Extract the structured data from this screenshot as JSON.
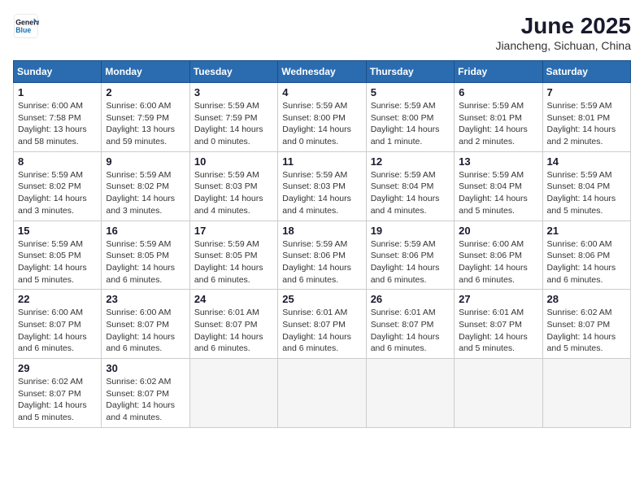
{
  "logo": {
    "line1": "General",
    "line2": "Blue"
  },
  "title": "June 2025",
  "subtitle": "Jiancheng, Sichuan, China",
  "days_of_week": [
    "Sunday",
    "Monday",
    "Tuesday",
    "Wednesday",
    "Thursday",
    "Friday",
    "Saturday"
  ],
  "weeks": [
    [
      {
        "day": "1",
        "info": "Sunrise: 6:00 AM\nSunset: 7:58 PM\nDaylight: 13 hours\nand 58 minutes."
      },
      {
        "day": "2",
        "info": "Sunrise: 6:00 AM\nSunset: 7:59 PM\nDaylight: 13 hours\nand 59 minutes."
      },
      {
        "day": "3",
        "info": "Sunrise: 5:59 AM\nSunset: 7:59 PM\nDaylight: 14 hours\nand 0 minutes."
      },
      {
        "day": "4",
        "info": "Sunrise: 5:59 AM\nSunset: 8:00 PM\nDaylight: 14 hours\nand 0 minutes."
      },
      {
        "day": "5",
        "info": "Sunrise: 5:59 AM\nSunset: 8:00 PM\nDaylight: 14 hours\nand 1 minute."
      },
      {
        "day": "6",
        "info": "Sunrise: 5:59 AM\nSunset: 8:01 PM\nDaylight: 14 hours\nand 2 minutes."
      },
      {
        "day": "7",
        "info": "Sunrise: 5:59 AM\nSunset: 8:01 PM\nDaylight: 14 hours\nand 2 minutes."
      }
    ],
    [
      {
        "day": "8",
        "info": "Sunrise: 5:59 AM\nSunset: 8:02 PM\nDaylight: 14 hours\nand 3 minutes."
      },
      {
        "day": "9",
        "info": "Sunrise: 5:59 AM\nSunset: 8:02 PM\nDaylight: 14 hours\nand 3 minutes."
      },
      {
        "day": "10",
        "info": "Sunrise: 5:59 AM\nSunset: 8:03 PM\nDaylight: 14 hours\nand 4 minutes."
      },
      {
        "day": "11",
        "info": "Sunrise: 5:59 AM\nSunset: 8:03 PM\nDaylight: 14 hours\nand 4 minutes."
      },
      {
        "day": "12",
        "info": "Sunrise: 5:59 AM\nSunset: 8:04 PM\nDaylight: 14 hours\nand 4 minutes."
      },
      {
        "day": "13",
        "info": "Sunrise: 5:59 AM\nSunset: 8:04 PM\nDaylight: 14 hours\nand 5 minutes."
      },
      {
        "day": "14",
        "info": "Sunrise: 5:59 AM\nSunset: 8:04 PM\nDaylight: 14 hours\nand 5 minutes."
      }
    ],
    [
      {
        "day": "15",
        "info": "Sunrise: 5:59 AM\nSunset: 8:05 PM\nDaylight: 14 hours\nand 5 minutes."
      },
      {
        "day": "16",
        "info": "Sunrise: 5:59 AM\nSunset: 8:05 PM\nDaylight: 14 hours\nand 6 minutes."
      },
      {
        "day": "17",
        "info": "Sunrise: 5:59 AM\nSunset: 8:05 PM\nDaylight: 14 hours\nand 6 minutes."
      },
      {
        "day": "18",
        "info": "Sunrise: 5:59 AM\nSunset: 8:06 PM\nDaylight: 14 hours\nand 6 minutes."
      },
      {
        "day": "19",
        "info": "Sunrise: 5:59 AM\nSunset: 8:06 PM\nDaylight: 14 hours\nand 6 minutes."
      },
      {
        "day": "20",
        "info": "Sunrise: 6:00 AM\nSunset: 8:06 PM\nDaylight: 14 hours\nand 6 minutes."
      },
      {
        "day": "21",
        "info": "Sunrise: 6:00 AM\nSunset: 8:06 PM\nDaylight: 14 hours\nand 6 minutes."
      }
    ],
    [
      {
        "day": "22",
        "info": "Sunrise: 6:00 AM\nSunset: 8:07 PM\nDaylight: 14 hours\nand 6 minutes."
      },
      {
        "day": "23",
        "info": "Sunrise: 6:00 AM\nSunset: 8:07 PM\nDaylight: 14 hours\nand 6 minutes."
      },
      {
        "day": "24",
        "info": "Sunrise: 6:01 AM\nSunset: 8:07 PM\nDaylight: 14 hours\nand 6 minutes."
      },
      {
        "day": "25",
        "info": "Sunrise: 6:01 AM\nSunset: 8:07 PM\nDaylight: 14 hours\nand 6 minutes."
      },
      {
        "day": "26",
        "info": "Sunrise: 6:01 AM\nSunset: 8:07 PM\nDaylight: 14 hours\nand 6 minutes."
      },
      {
        "day": "27",
        "info": "Sunrise: 6:01 AM\nSunset: 8:07 PM\nDaylight: 14 hours\nand 5 minutes."
      },
      {
        "day": "28",
        "info": "Sunrise: 6:02 AM\nSunset: 8:07 PM\nDaylight: 14 hours\nand 5 minutes."
      }
    ],
    [
      {
        "day": "29",
        "info": "Sunrise: 6:02 AM\nSunset: 8:07 PM\nDaylight: 14 hours\nand 5 minutes."
      },
      {
        "day": "30",
        "info": "Sunrise: 6:02 AM\nSunset: 8:07 PM\nDaylight: 14 hours\nand 4 minutes."
      },
      {
        "day": "",
        "info": ""
      },
      {
        "day": "",
        "info": ""
      },
      {
        "day": "",
        "info": ""
      },
      {
        "day": "",
        "info": ""
      },
      {
        "day": "",
        "info": ""
      }
    ]
  ]
}
